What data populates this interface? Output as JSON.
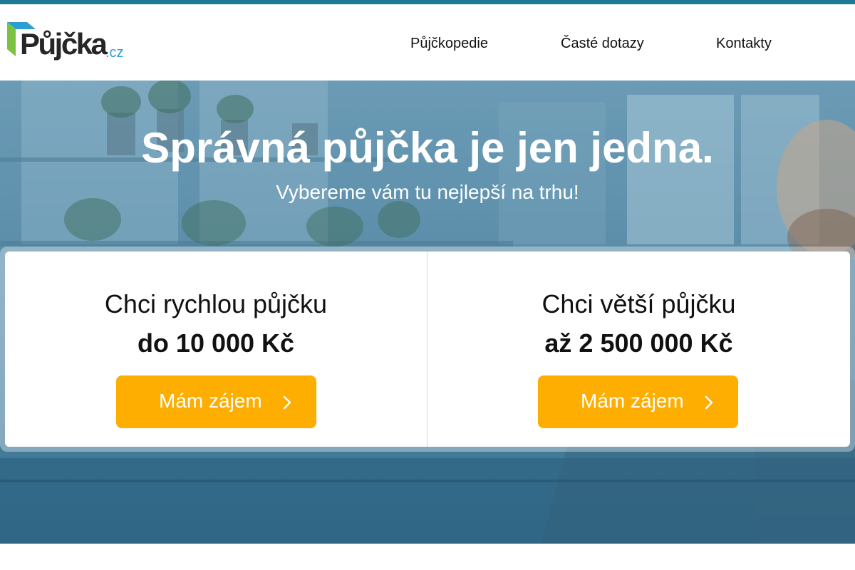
{
  "brand": {
    "name": "Půjčka",
    "tld": ".cz"
  },
  "nav": {
    "items": [
      "Půjčkopedie",
      "Časté dotazy",
      "Kontakty"
    ]
  },
  "hero": {
    "title": "Správná půjčka je jen jedna.",
    "subtitle": "Vybereme vám tu nejlepší na trhu!"
  },
  "offers": [
    {
      "title": "Chci rychlou půjčku",
      "amount": "do 10 000 Kč",
      "button": "Mám zájem"
    },
    {
      "title": "Chci větší půjčku",
      "amount": "až 2 500 000 Kč",
      "button": "Mám zájem"
    }
  ],
  "colors": {
    "accent": "#fdae00",
    "brand_blue": "#1f7a99",
    "logo_green": "#7cc242",
    "logo_cyan": "#2a9fd0"
  },
  "icons": {
    "button": "chevron-right-icon",
    "logo": "box-icon"
  }
}
